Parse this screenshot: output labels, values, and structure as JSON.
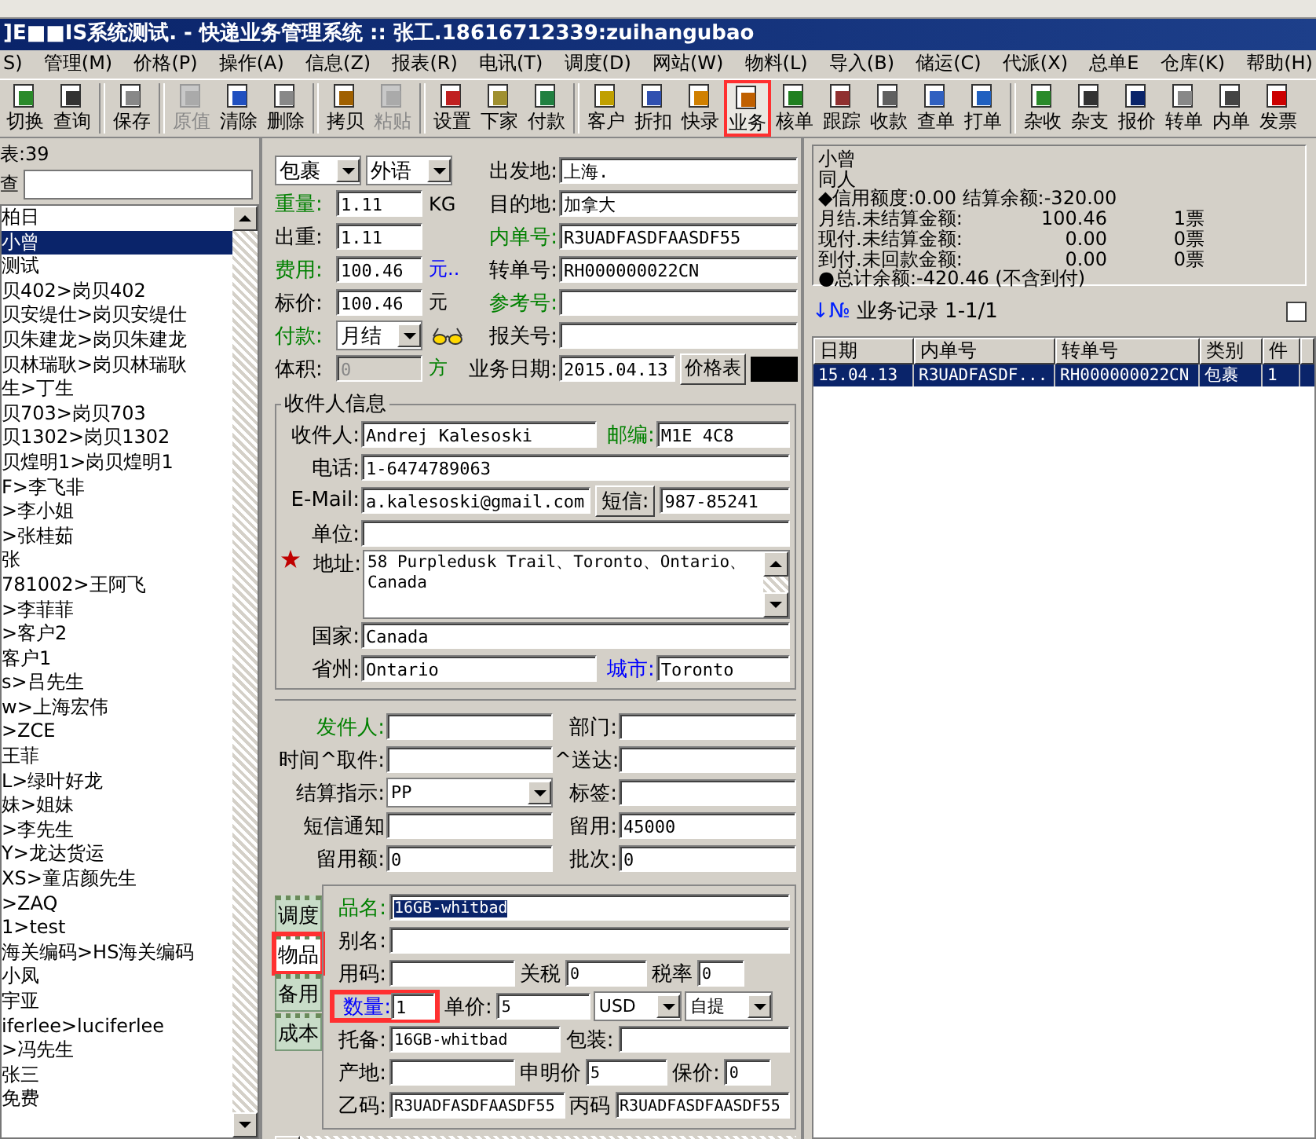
{
  "window": {
    "title": "]E■■IS系统测试. - 快递业务管理系统 :: 张工.18616712339:zuihangubao"
  },
  "menu": [
    "S)",
    "管理(M)",
    "价格(P)",
    "操作(A)",
    "信息(Z)",
    "报表(R)",
    "电讯(T)",
    "调度(D)",
    "网站(W)",
    "物料(L)",
    "导入(B)",
    "储运(C)",
    "代派(X)",
    "总单E",
    "仓库(K)",
    "帮助(H)"
  ],
  "toolbar": [
    {
      "kind": "button",
      "label": "切换",
      "disabled": false
    },
    {
      "kind": "button",
      "label": "查询",
      "disabled": false
    },
    {
      "kind": "separator"
    },
    {
      "kind": "button",
      "label": "保存",
      "disabled": false
    },
    {
      "kind": "separator"
    },
    {
      "kind": "button",
      "label": "原值",
      "disabled": true
    },
    {
      "kind": "button",
      "label": "清除",
      "disabled": false
    },
    {
      "kind": "button",
      "label": "删除",
      "disabled": false
    },
    {
      "kind": "separator"
    },
    {
      "kind": "button",
      "label": "拷贝",
      "disabled": false
    },
    {
      "kind": "button",
      "label": "粘贴",
      "disabled": true
    },
    {
      "kind": "separator"
    },
    {
      "kind": "button",
      "label": "设置",
      "disabled": false
    },
    {
      "kind": "button",
      "label": "下家",
      "disabled": false
    },
    {
      "kind": "button",
      "label": "付款",
      "disabled": false
    },
    {
      "kind": "separator"
    },
    {
      "kind": "button",
      "label": "客户",
      "disabled": false
    },
    {
      "kind": "button",
      "label": "折扣",
      "disabled": false
    },
    {
      "kind": "button",
      "label": "快录",
      "disabled": false
    },
    {
      "kind": "button",
      "label": "业务",
      "disabled": false,
      "annotated": true
    },
    {
      "kind": "button",
      "label": "核单",
      "disabled": false
    },
    {
      "kind": "button",
      "label": "跟踪",
      "disabled": false
    },
    {
      "kind": "button",
      "label": "收款",
      "disabled": false
    },
    {
      "kind": "button",
      "label": "查单",
      "disabled": false
    },
    {
      "kind": "button",
      "label": "打单",
      "disabled": false
    },
    {
      "kind": "separator"
    },
    {
      "kind": "button",
      "label": "杂收",
      "disabled": false
    },
    {
      "kind": "button",
      "label": "杂支",
      "disabled": false
    },
    {
      "kind": "button",
      "label": "报价",
      "disabled": false
    },
    {
      "kind": "button",
      "label": "转单",
      "disabled": false
    },
    {
      "kind": "button",
      "label": "内单",
      "disabled": false
    },
    {
      "kind": "button",
      "label": "发票",
      "disabled": false
    }
  ],
  "customer_list": {
    "count_label": "表:39",
    "search_label": "查",
    "items": [
      {
        "label": "柏日",
        "selected": false
      },
      {
        "label": "小曾",
        "selected": true
      },
      {
        "label": "测试",
        "selected": false
      },
      {
        "label": "贝402>岗贝402",
        "selected": false
      },
      {
        "label": "贝安缇仕>岗贝安缇仕",
        "selected": false
      },
      {
        "label": "贝朱建龙>岗贝朱建龙",
        "selected": false
      },
      {
        "label": "贝林瑞耿>岗贝林瑞耿",
        "selected": false
      },
      {
        "label": "生>丁生",
        "selected": false
      },
      {
        "label": "贝703>岗贝703",
        "selected": false
      },
      {
        "label": "贝1302>岗贝1302",
        "selected": false
      },
      {
        "label": "贝煌明1>岗贝煌明1",
        "selected": false
      },
      {
        "label": "F>李飞非",
        "selected": false
      },
      {
        "label": ">李小姐",
        "selected": false
      },
      {
        "label": ">张桂茹",
        "selected": false
      },
      {
        "label": "张",
        "selected": false
      },
      {
        "label": "781002>王阿飞",
        "selected": false
      },
      {
        "label": ">李菲菲",
        "selected": false
      },
      {
        "label": ">客户2",
        "selected": false
      },
      {
        "label": "客户1",
        "selected": false
      },
      {
        "label": "s>吕先生",
        "selected": false
      },
      {
        "label": "w>上海宏伟",
        "selected": false
      },
      {
        "label": ">ZCE",
        "selected": false
      },
      {
        "label": "王菲",
        "selected": false
      },
      {
        "label": "L>绿叶好龙",
        "selected": false
      },
      {
        "label": "妹>姐妹",
        "selected": false
      },
      {
        "label": ">李先生",
        "selected": false
      },
      {
        "label": "Y>龙达货运",
        "selected": false
      },
      {
        "label": "XS>童店颜先生",
        "selected": false
      },
      {
        "label": ">ZAQ",
        "selected": false
      },
      {
        "label": "1>test",
        "selected": false
      },
      {
        "label": "海关编码>HS海关编码",
        "selected": false
      },
      {
        "label": "小凤",
        "selected": false
      },
      {
        "label": "宇亚",
        "selected": false
      },
      {
        "label": "iferlee>luciferlee",
        "selected": false
      },
      {
        "label": ">冯先生",
        "selected": false
      },
      {
        "label": "张三",
        "selected": false
      },
      {
        "label": "免费",
        "selected": false
      }
    ]
  },
  "shipment": {
    "type_select": "包裹",
    "lang_select": "外语",
    "left_fields": [
      {
        "label": "重量:",
        "color": "#008000",
        "kind": "text",
        "value": "1.11",
        "unit": {
          "text": "KG",
          "color": "#000000"
        }
      },
      {
        "label": "出重:",
        "color": "#000000",
        "kind": "text",
        "value": "1.11"
      },
      {
        "label": "费用:",
        "color": "#008000",
        "kind": "text",
        "value": "100.46",
        "unit": {
          "text": "元..",
          "color": "#0000ff"
        }
      },
      {
        "label": "标价:",
        "color": "#000000",
        "kind": "text",
        "value": "100.46",
        "unit": {
          "text": "元",
          "color": "#000000"
        }
      },
      {
        "label": "付款:",
        "color": "#008000",
        "kind": "select",
        "value": "月结"
      },
      {
        "label": "体积:",
        "color": "#000000",
        "kind": "text",
        "value": "0",
        "disabled": true,
        "unit": {
          "text": "方",
          "color": "#008000"
        }
      }
    ],
    "right_fields": [
      {
        "label": "出发地:",
        "color": "#000000",
        "value": "上海."
      },
      {
        "label": "目的地:",
        "color": "#000000",
        "value": "加拿大"
      },
      {
        "label": "内单号:",
        "color": "#008000",
        "value": "R3UADFASDFAASDF55"
      },
      {
        "label": "转单号:",
        "color": "#000000",
        "value": "RH000000022CN"
      },
      {
        "label": "参考号:",
        "color": "#008000"
      },
      {
        "label": "报关号:",
        "color": "#000000"
      }
    ],
    "date_label": "业务日期:",
    "date_value": "2015.04.13",
    "price_button": "价格表"
  },
  "recipient": {
    "title": "收件人信息",
    "rows": [
      [
        {
          "label": "收件人:",
          "color": "#000000",
          "kind": "text",
          "value": "Andrej Kalesoski"
        },
        {
          "label": "邮编:",
          "color": "#008000",
          "kind": "text",
          "value": "M1E 4C8"
        }
      ],
      [
        {
          "label": "电话:",
          "color": "#000000",
          "kind": "text",
          "value": "1-6474789063"
        }
      ],
      [
        {
          "label": "E-Mail:",
          "color": "#000000",
          "kind": "text",
          "value": "a.kalesoski@gmail.com"
        },
        {
          "label": "短信:",
          "color": "#000000",
          "kind": "button",
          "value": "987-85241"
        }
      ],
      [
        {
          "label": "单位:",
          "color": "#000000",
          "kind": "text"
        }
      ],
      [
        {
          "label": "地址:",
          "color": "#000000",
          "kind": "textarea",
          "value": "58 Purpledusk Trail、Toronto、Ontario、Canada"
        }
      ],
      [
        {
          "label": "国家:",
          "color": "#000000",
          "kind": "text",
          "value": "Canada"
        }
      ],
      [
        {
          "label": "省州:",
          "color": "#000000",
          "kind": "text",
          "value": "Ontario"
        },
        {
          "label": "城市:",
          "color": "#0000ff",
          "kind": "text",
          "value": "Toronto"
        }
      ]
    ]
  },
  "sender": {
    "rows": [
      [
        {
          "label": "发件人:",
          "color": "#008000",
          "kind": "text"
        },
        {
          "label": "部门:",
          "color": "#000000",
          "kind": "text"
        }
      ],
      [
        {
          "label": "时间^取件:",
          "color": "#000000",
          "kind": "text"
        },
        {
          "label": "^送达:",
          "color": "#000000",
          "kind": "text"
        }
      ],
      [
        {
          "label": "结算指示:",
          "color": "#000000",
          "kind": "select",
          "value": "PP"
        },
        {
          "label": "标签:",
          "color": "#000000",
          "kind": "text"
        }
      ],
      [
        {
          "label": "短信通知",
          "color": "#000000",
          "kind": "text"
        },
        {
          "label": "留用:",
          "color": "#000000",
          "kind": "text",
          "value": "45000"
        }
      ],
      [
        {
          "label": "留用额:",
          "color": "#000000",
          "kind": "text",
          "value": "0"
        },
        {
          "label": "批次:",
          "color": "#000000",
          "kind": "text",
          "value": "0"
        }
      ]
    ]
  },
  "goods": {
    "tabs": [
      {
        "label": "调度",
        "selected": false
      },
      {
        "label": "物品",
        "selected": true,
        "annotated": true
      },
      {
        "label": "备用",
        "selected": false
      },
      {
        "label": "成本",
        "selected": false
      }
    ],
    "rows": [
      [
        {
          "label": "品名:",
          "color": "#008000",
          "kind": "text",
          "value": "16GB-whitbad",
          "text_selected": true
        }
      ],
      [
        {
          "label": "别名:",
          "color": "#000000",
          "kind": "text"
        }
      ],
      [
        {
          "label": "用码:",
          "color": "#000000",
          "kind": "text"
        },
        {
          "label": "关税",
          "color": "#000000",
          "kind": "text",
          "value": "0"
        },
        {
          "label": "税率",
          "color": "#000000",
          "kind": "text",
          "value": "0"
        }
      ],
      [
        {
          "label": "数量:",
          "color": "#0000ff",
          "kind": "text",
          "value": "1",
          "annotated": true
        },
        {
          "label": "单价:",
          "color": "#000000",
          "kind": "text",
          "value": "5"
        },
        {
          "kind": "select",
          "value": "USD"
        },
        {
          "kind": "select",
          "value": "自提"
        }
      ],
      [
        {
          "label": "托备:",
          "color": "#000000",
          "kind": "text",
          "value": "16GB-whitbad"
        },
        {
          "label": "包装:",
          "color": "#000000",
          "kind": "text"
        }
      ],
      [
        {
          "label": "产地:",
          "color": "#000000",
          "kind": "text"
        },
        {
          "label": "申明价",
          "color": "#000000",
          "kind": "text",
          "value": "5"
        },
        {
          "label": "保价:",
          "color": "#000000",
          "kind": "text",
          "value": "0"
        }
      ],
      [
        {
          "label": "乙码:",
          "color": "#000000",
          "kind": "text",
          "value": "R3UADFASDFAASDF55"
        },
        {
          "label": "丙码",
          "color": "#000000",
          "kind": "text",
          "value": "R3UADFASDFAASDF55"
        }
      ]
    ]
  },
  "account": {
    "name": "小曾",
    "sub": "同人",
    "credit_line": "◆信用额度:0.00 结算余额:-320.00",
    "balances": [
      {
        "label": "月结.未结算金额:",
        "amount": "100.46",
        "count": "1票"
      },
      {
        "label": "现付.未结算金额:",
        "amount": "0.00",
        "count": "0票"
      },
      {
        "label": "到付.未回款金额:",
        "amount": "0.00",
        "count": "0票"
      }
    ],
    "total": "●总计余额:-420.46 (不含到付)"
  },
  "records": {
    "sort_glyph": "↓№",
    "title": "业务记录 1-1/1",
    "checked": false,
    "columns": [
      "日期",
      "内单号",
      "转单号",
      "类别",
      "件"
    ],
    "rows": [
      {
        "cells": [
          "15.04.13",
          "R3UADFASDF...",
          "RH000000022CN",
          "包裹",
          "1"
        ],
        "selected": true
      }
    ]
  }
}
